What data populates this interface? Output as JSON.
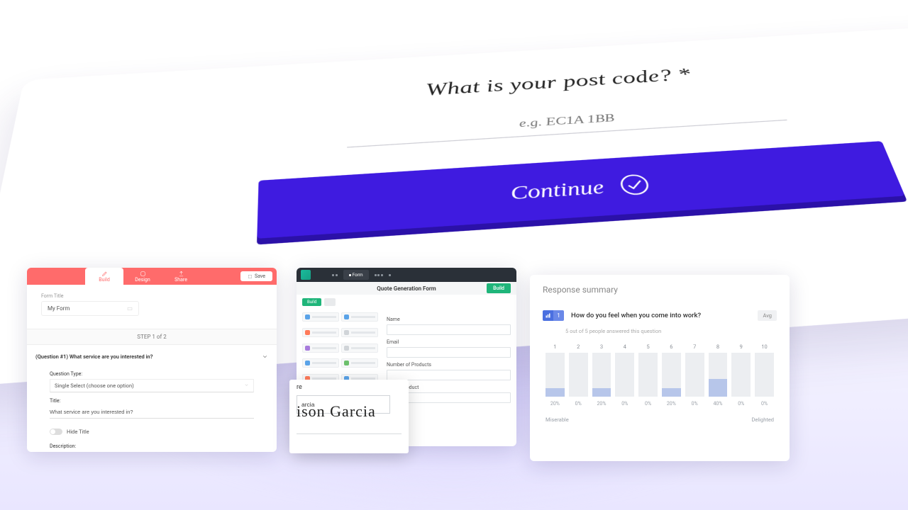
{
  "hero": {
    "question": "What is your post code? *",
    "placeholder": "e.g. EC1A 1BB",
    "button": "Continue"
  },
  "card1": {
    "tabs": [
      "Build",
      "Design",
      "Share"
    ],
    "save": "Save",
    "form_title_label": "Form Title",
    "form_title_value": "My Form",
    "step": "STEP 1 of 2",
    "question_header": "(Question #1) What service are you interested in?",
    "qtype_label": "Question Type:",
    "qtype_value": "Single Select (choose one option)",
    "title_label": "Title:",
    "title_value": "What service are you interested in?",
    "hide_title": "Hide Title",
    "desc_label": "Description:"
  },
  "card2": {
    "mode_label": "Form",
    "sub_title": "Quote Generation Form",
    "build_btn": "Build",
    "pill": "Build",
    "palette_colors": [
      "#5aa3e8",
      "#5aa3e8",
      "#ff7b5a",
      "#d0d4d8",
      "#a77bdc",
      "#d0d4d8",
      "#5aa3e8",
      "#6cc06c",
      "#ff7b5a",
      "#5aa3e8",
      "#ffb05a",
      "#ff6b6b"
    ],
    "fields": [
      "Name",
      "Email",
      "Number of Products",
      "Select Product"
    ]
  },
  "sig": {
    "label_suffix": "re",
    "value": "arcia",
    "signature": "ison Garcia"
  },
  "card3": {
    "title": "Response summary",
    "badge_num": "1",
    "question": "How do you feel when you come into work?",
    "avg": "Avg",
    "sub": "5 out of 5 people answered this question",
    "legend_left": "Miserable",
    "legend_right": "Delighted"
  },
  "chart_data": {
    "type": "bar",
    "title": "How do you feel when you come into work?",
    "xlabel": "",
    "ylabel": "",
    "ylim": [
      0,
      100
    ],
    "categories": [
      "1",
      "2",
      "3",
      "4",
      "5",
      "6",
      "7",
      "8",
      "9",
      "10"
    ],
    "values": [
      20,
      0,
      20,
      0,
      0,
      20,
      0,
      40,
      0,
      0
    ],
    "x_endpoint_labels": [
      "Miserable",
      "Delighted"
    ],
    "annotations": {
      "respondents": "5 out of 5 people answered this question"
    }
  }
}
